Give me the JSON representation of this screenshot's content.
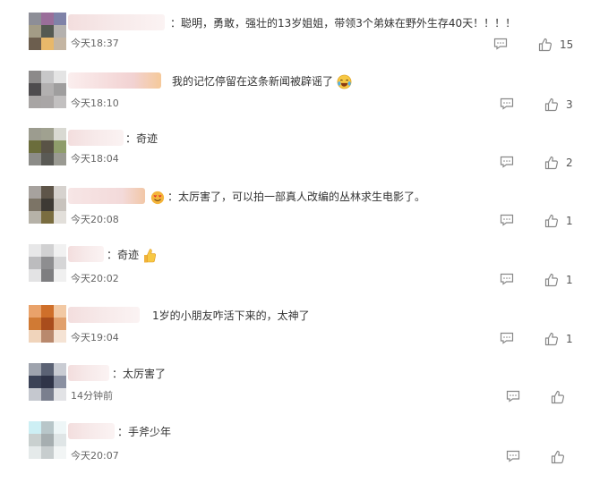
{
  "comments": [
    {
      "text": "：聪明，勇敢，强壮的13岁姐姐，带领3个弟妹在野外生存40天！！！！",
      "time": "今天18:37",
      "likes": "15"
    },
    {
      "text": "我的记忆停留在这条新闻被辟谣了",
      "time": "今天18:10",
      "likes": "3"
    },
    {
      "text": "：奇迹",
      "time": "今天18:04",
      "likes": "2"
    },
    {
      "text": "：太厉害了，可以拍一部真人改编的丛林求生电影了。",
      "time": "今天20:08",
      "likes": "1"
    },
    {
      "text": "：奇迹",
      "time": "今天20:02",
      "likes": "1"
    },
    {
      "text": "1岁的小朋友咋活下来的，太神了",
      "time": "今天19:04",
      "likes": "1"
    },
    {
      "text": "：太厉害了",
      "time": "14分钟前",
      "likes": ""
    },
    {
      "text": "：手斧少年",
      "time": "今天20:07",
      "likes": ""
    }
  ],
  "icons": {
    "reply": "comment-icon",
    "like": "thumbs-up-icon",
    "laugh": "laugh-cry-emoji",
    "thumb": "thumbs-up-emoji"
  }
}
